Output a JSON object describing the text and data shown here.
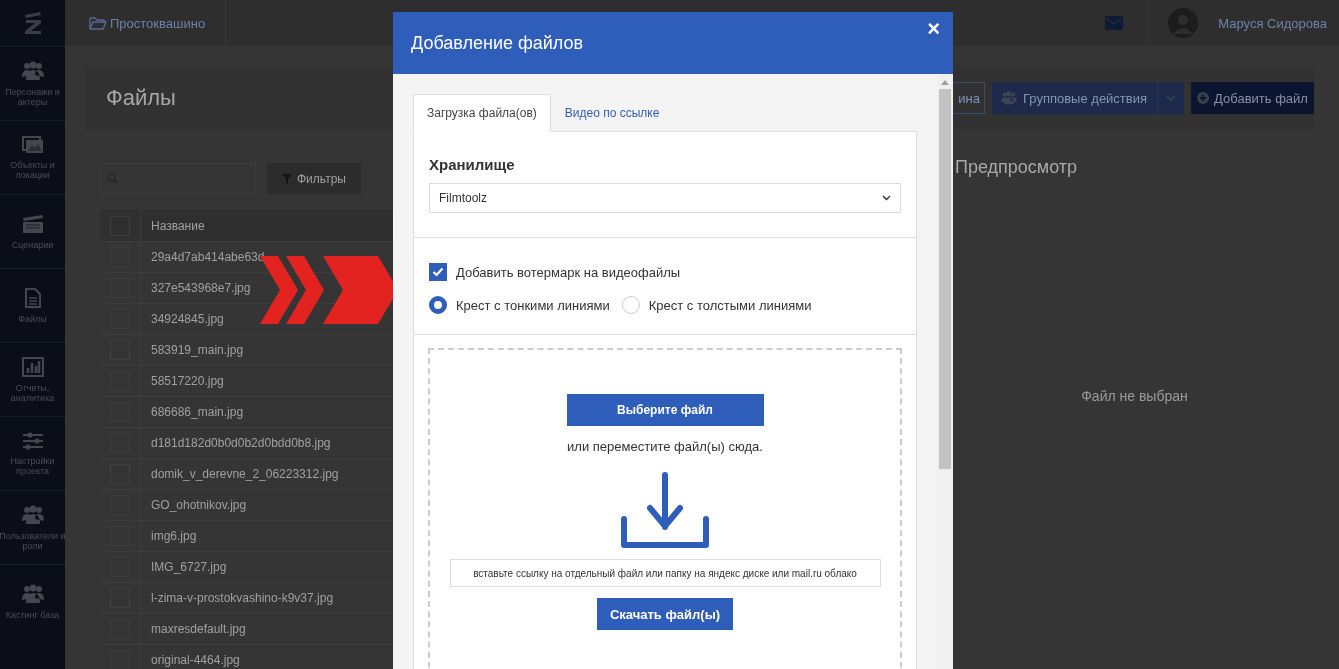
{
  "sidebar": {
    "items": [
      {
        "label": "Персонажи и актеры"
      },
      {
        "label": "Объекты и локации"
      },
      {
        "label": "Сценарии"
      },
      {
        "label": "Файлы"
      },
      {
        "label": "Отчеты, аналитика"
      },
      {
        "label": "Настройки проекта"
      },
      {
        "label": "Пользователи и роли"
      },
      {
        "label": "Кастинг база"
      }
    ]
  },
  "topbar": {
    "breadcrumb": "Простоквашино",
    "user_name": "Маруся Сидорова"
  },
  "page": {
    "title": "Файлы",
    "buttons": [
      {
        "label": "ина",
        "kind": "outline"
      },
      {
        "label": "Групповые действия",
        "kind": "split"
      },
      {
        "label": "Добавить файл",
        "kind": "primary"
      }
    ]
  },
  "toolbar": {
    "filter_button": "Фильтры"
  },
  "table": {
    "columns": [
      "Название"
    ],
    "all_checked": false,
    "rows": [
      {
        "name": "29a4d7ab414abe63d",
        "checked": false
      },
      {
        "name": "327e543968e7.jpg",
        "checked": false
      },
      {
        "name": "34924845.jpg",
        "checked": false
      },
      {
        "name": "583919_main.jpg",
        "checked": false
      },
      {
        "name": "58517220.jpg",
        "checked": false
      },
      {
        "name": "686686_main.jpg",
        "checked": false
      },
      {
        "name": "d181d182d0b0d0b2d0bdd0b8.jpg",
        "checked": false
      },
      {
        "name": "domik_v_derevne_2_06223312.jpg",
        "checked": false
      },
      {
        "name": "GO_ohotnikov.jpg",
        "checked": false
      },
      {
        "name": "img6.jpg",
        "checked": false
      },
      {
        "name": "IMG_6727.jpg",
        "checked": false
      },
      {
        "name": "l-zima-v-prostokvashino-k9v37.jpg",
        "checked": false
      },
      {
        "name": "maxresdefault.jpg",
        "checked": false
      },
      {
        "name": "original-4464.jpg",
        "checked": false
      }
    ]
  },
  "preview": {
    "title": "Предпросмотр",
    "empty_text": "Файл не выбран"
  },
  "dialog": {
    "title": "Добавление файлов",
    "close": "×",
    "tabs": [
      {
        "label": "Загрузка файла(ов)",
        "selected": true
      },
      {
        "label": "Видео по ссылке",
        "selected": false
      }
    ],
    "storage_label": "Хранилище",
    "storage_value": "Filmtoolz",
    "watermark": {
      "label": "Добавить вотермарк на видеофайлы",
      "checked": true
    },
    "options": [
      {
        "label": "Крест с тонкими линиями",
        "selected": true
      },
      {
        "label": "Крест с толстыми линиями",
        "selected": false
      }
    ],
    "choose_button": "Выберите файл",
    "drop_hint": "или переместите файл(ы) сюда.",
    "link_placeholder": "вставьте ссылку на отдельный файл или папку на яндекс диске или mail.ru облако",
    "download_button": "Скачать файл(ы)"
  }
}
